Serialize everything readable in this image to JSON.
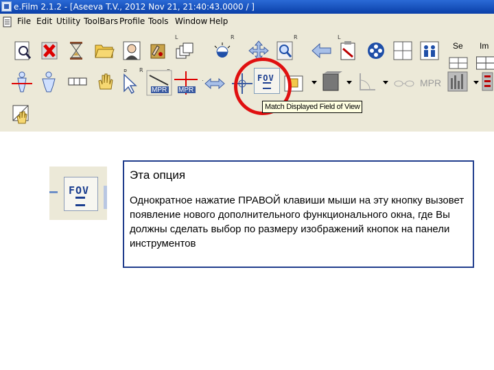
{
  "window": {
    "title": "e.Film 2.1.2 - [Aseeva T.V., 2012 Nov 21, 21:40:43.0000  /  ]"
  },
  "menu": {
    "items": [
      "File",
      "Edit",
      "Utility",
      "ToolBars",
      "Profile",
      "Tools",
      "Window",
      "Help"
    ]
  },
  "toolbar": {
    "se_label": "Se",
    "im_label": "Im",
    "fov_text": "FOV",
    "fov_eq": "=",
    "mpr_label": "MPR",
    "mini_r": "R",
    "mini_l": "L",
    "tooltip": "Match Displayed Field of View"
  },
  "callout": {
    "fov_text": "FOV",
    "title": "Эта опция",
    "body": "Однократное нажатие ПРАВОЙ клавиши мыши на эту кнопку вызовет появление нового дополнительного функционального окна, где Вы должны сделать выбор по размеру изображений кнопок на панели инструментов"
  },
  "colors": {
    "titlebar": "#0a3fa8",
    "toolbar_bg": "#ece9d8",
    "highlight_circle": "#e01010",
    "box_border": "#1f3c8c"
  }
}
